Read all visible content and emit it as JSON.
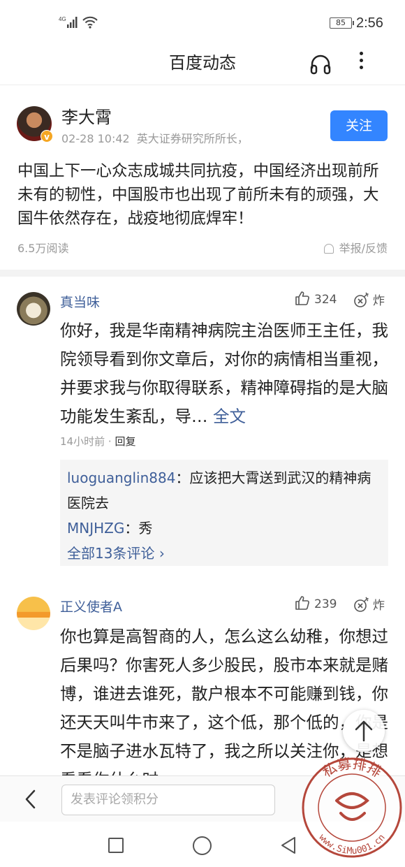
{
  "status_bar": {
    "network": "4G",
    "battery": "85",
    "time": "2:56"
  },
  "header": {
    "title": "百度动态",
    "headphone_icon": "headphone-icon",
    "more_icon": "more-vertical-icon"
  },
  "post": {
    "author": "李大霄",
    "time": "02-28 10:42",
    "author_title": "英大证券研究所所长，",
    "follow_label": "关注",
    "verified_badge": "v",
    "content": "中国上下一心众志成城共同抗疫，中国经济出现前所未有的韧性，中国股市也出现了前所未有的顽强，大国牛依然存在，战疫地彻底焊牢！",
    "read_count": "6.5万阅读",
    "report_label": "举报/反馈"
  },
  "comments": [
    {
      "name": "真当味",
      "likes": "324",
      "bomb_label": "炸",
      "text": "你好，我是华南精神病院主治医师王主任，我院领导看到你文章后，对你的病情相当重视，并要求我与你取得联系，精神障碍指的是大脑功能发生紊乱，导…",
      "fulltext_label": "全文",
      "time": "14小时前",
      "separator": "·",
      "reply_label": "回复",
      "replies": [
        {
          "user": "luoguanglin884",
          "text": "：应该把大霄送到武汉的精神病医院去"
        },
        {
          "user": "MNJHZG",
          "text": "：秀"
        }
      ],
      "all_replies_label": "全部13条评论"
    },
    {
      "name": "正义使者A",
      "likes": "239",
      "bomb_label": "炸",
      "text": "你也算是高智商的人，怎么这么幼稚，你想过后果吗？你害死人多少股民，股市本来就是赌博，谁进去谁死，散户根本不可能赚到钱，你还天天叫牛市来了，这个低，那个低的，你是不是脑子进水瓦特了，我之所以关注你，是想看看你什么时"
    }
  ],
  "bottom_bar": {
    "comment_placeholder": "发表评论领积分"
  },
  "watermark": {
    "text_cn": "私募排排",
    "url": "www.SiMu001.cn"
  }
}
